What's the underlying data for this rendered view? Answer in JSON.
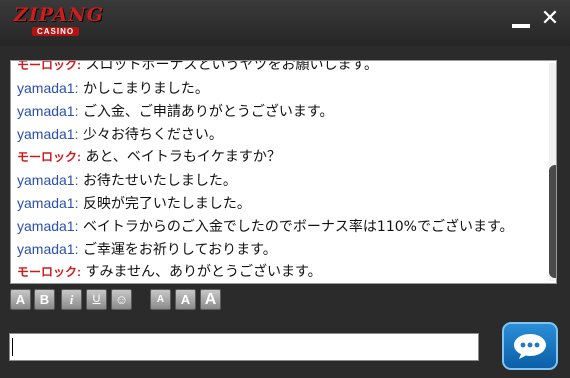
{
  "app": {
    "logo_text": "ZIPANG",
    "logo_sub": "CASINO"
  },
  "window": {
    "minimize_icon": "minimize-icon",
    "close_symbol": "✕"
  },
  "messages": [
    {
      "sender": "モーロック:",
      "type": "operator",
      "text": "スロットボーナスというヤツをお願いします。"
    },
    {
      "sender": "yamada1:",
      "type": "agent",
      "text": "かしこまりました。"
    },
    {
      "sender": "yamada1:",
      "type": "agent",
      "text": "ご入金、ご申請ありがとうございます。"
    },
    {
      "sender": "yamada1:",
      "type": "agent",
      "text": "少々お待ちください。"
    },
    {
      "sender": "モーロック:",
      "type": "operator",
      "text": "あと、ベイトラもイケますか？"
    },
    {
      "sender": "yamada1:",
      "type": "agent",
      "text": "お待たせいたしました。"
    },
    {
      "sender": "yamada1:",
      "type": "agent",
      "text": "反映が完了いたしました。"
    },
    {
      "sender": "yamada1:",
      "type": "agent",
      "text": "ベイトラからのご入金でしたのでボーナス率は110%でございます。"
    },
    {
      "sender": "yamada1:",
      "type": "agent",
      "text": "ご幸運をお祈りしております。"
    },
    {
      "sender": "モーロック:",
      "type": "operator",
      "text": "すみません、ありがとうございます。"
    }
  ],
  "toolbar": {
    "bold": "A",
    "bold2": "B",
    "italic": "i",
    "underline": "U",
    "emoji": "☺",
    "size_small": "A",
    "size_medium": "A",
    "size_large": "A"
  },
  "input": {
    "value": "",
    "placeholder": ""
  },
  "colors": {
    "operator": "#d11a1a",
    "agent": "#2a4fb0",
    "send": "#1a7ac8"
  }
}
